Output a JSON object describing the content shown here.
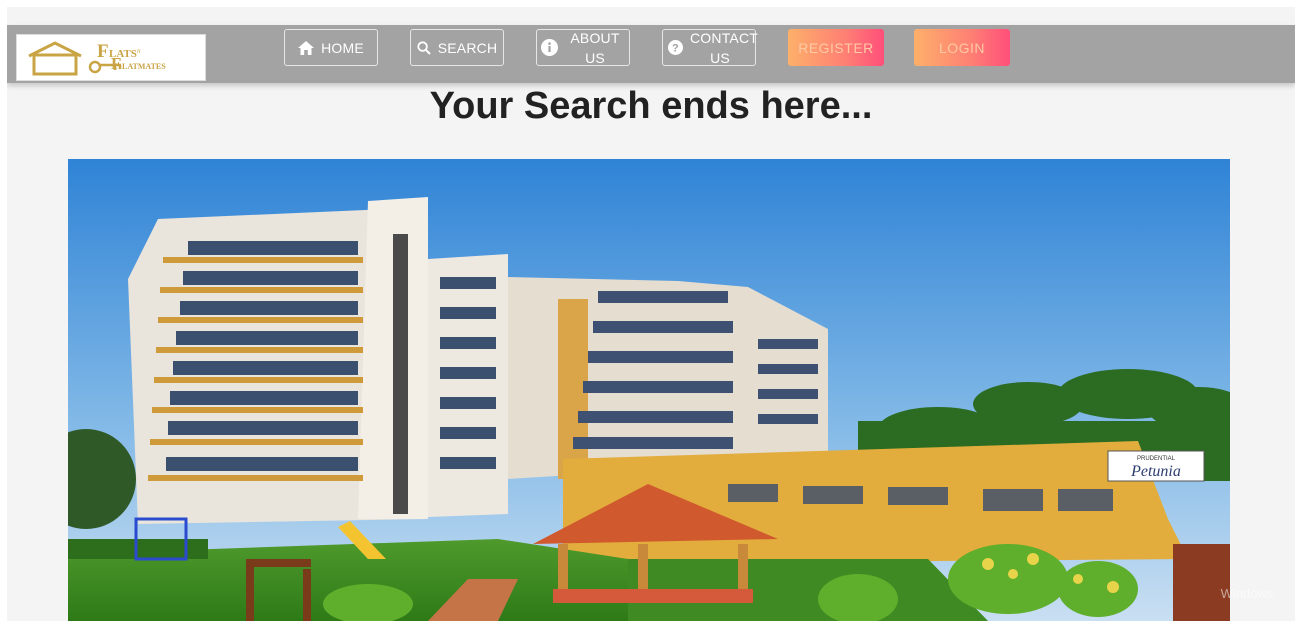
{
  "nav": {
    "home": "HOME",
    "search": "SEARCH",
    "about_l1": "ABOUT",
    "about_l2": "US",
    "contact_l1": "CONTACT",
    "contact_l2": "US",
    "register": "REGISTER",
    "login": "LOGIN"
  },
  "logo": {
    "line1": "LATS",
    "line2": "LATMATES",
    "brand_color": "#c9a445"
  },
  "hero": {
    "headline": "Your Search ends here...",
    "sign_top": "PRUDENTIAL",
    "sign_name": "Petunia"
  },
  "watermark": "Windows.",
  "icons": [
    "home-icon",
    "search-icon",
    "info-icon",
    "question-icon"
  ],
  "colors": {
    "navbar": "#a3a3a3",
    "page_bg": "#f4f4f4",
    "gradient_start": "#fdb06a",
    "gradient_end": "#ff4f7a"
  }
}
